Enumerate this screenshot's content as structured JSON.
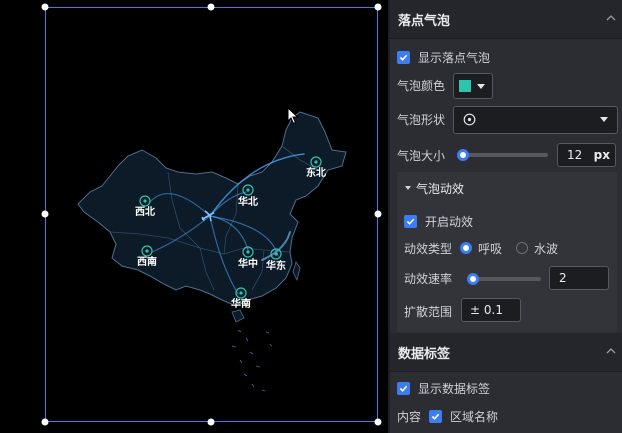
{
  "map": {
    "regions": [
      {
        "name": "东北"
      },
      {
        "name": "西北"
      },
      {
        "name": "华北"
      },
      {
        "name": "西南"
      },
      {
        "name": "华中"
      },
      {
        "name": "华东"
      },
      {
        "name": "华南"
      }
    ]
  },
  "panel": {
    "sections": {
      "bubble": {
        "title": "落点气泡"
      },
      "labels": {
        "title": "数据标签"
      }
    },
    "bubble": {
      "show_label": "显示落点气泡",
      "show_checked": true,
      "color_label": "气泡颜色",
      "color_value": "#2cc4ad",
      "shape_label": "气泡形状",
      "shape_value": "circle-dot-icon",
      "size_label": "气泡大小",
      "size_value": "12",
      "size_unit": "px",
      "size_fraction": 0.05
    },
    "animation": {
      "title": "气泡动效",
      "enable_label": "开启动效",
      "enable_checked": true,
      "type_label": "动效类型",
      "type_options": [
        "呼吸",
        "水波"
      ],
      "type_selected": "呼吸",
      "rate_label": "动效速率",
      "rate_value": "2",
      "rate_fraction": 0.02,
      "spread_label": "扩散范围",
      "spread_value": "± 0.1"
    },
    "data_labels": {
      "show_label": "显示数据标签",
      "show_checked": true,
      "content_label": "内容",
      "region_name_label": "区域名称",
      "region_name_checked": true
    }
  },
  "colors": {
    "accent": "#3d7cf2",
    "bubble": "#2cc4ad",
    "map_fill": "#0d1a27",
    "map_stroke": "#4e6f8e"
  }
}
